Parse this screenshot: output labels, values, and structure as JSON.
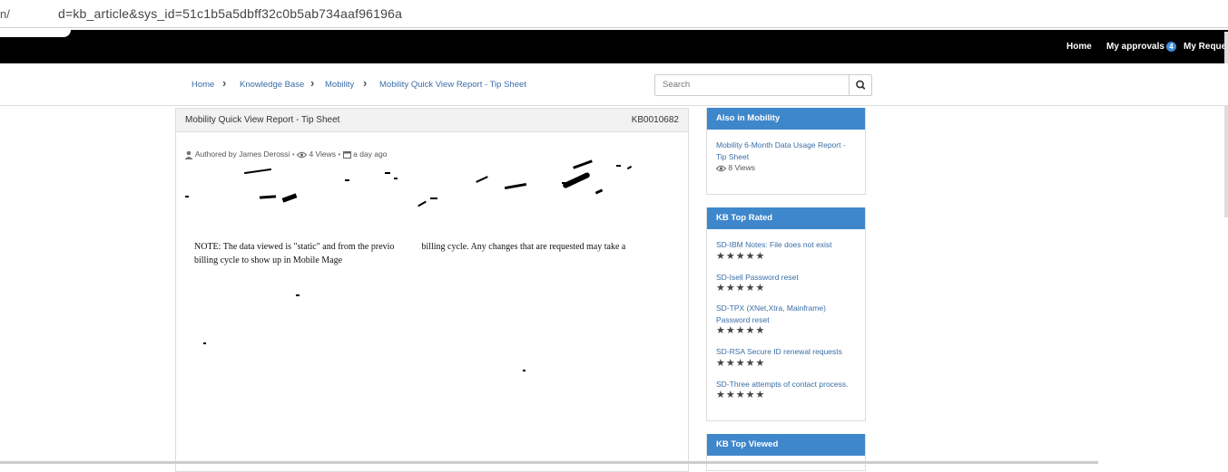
{
  "browser": {
    "url_prefix": "n/",
    "url": "d=kb_article&sys_id=51c1b5a5dbff32c0b5ab734aaf96196a"
  },
  "nav": {
    "home": "Home",
    "approvals": "My approvals",
    "approvals_count": "4",
    "requests": "My Requests"
  },
  "breadcrumb": {
    "items": [
      "Home",
      "Knowledge Base",
      "Mobility",
      "Mobility Quick View Report - Tip Sheet"
    ]
  },
  "search": {
    "placeholder": "Search"
  },
  "article": {
    "title": "Mobility Quick View Report - Tip Sheet",
    "number": "KB0010682",
    "author": "Authored by James Derossi",
    "views": "4 Views",
    "age": "a day ago",
    "note_line1": "NOTE: The data viewed is \"static\" and from the previo",
    "note_line1b": "billing cycle. Any changes that are requested may take a",
    "note_line2": "billing cycle to show up in Mobile M",
    "note_line2b": "age"
  },
  "sidebar": {
    "also_in": {
      "title": "Also in Mobility",
      "items": [
        {
          "label": "Mobility 6-Month Data Usage Report - Tip Sheet",
          "views": "8 Views"
        }
      ]
    },
    "top_rated": {
      "title": "KB Top Rated",
      "items": [
        {
          "label": "SD-IBM Notes: File does not exist",
          "stars": "★★★★★"
        },
        {
          "label": "SD-Isell Password reset",
          "stars": "★★★★★"
        },
        {
          "label": "SD-TPX (XNet,Xtra, Mainframe) Password reset",
          "stars": "★★★★★"
        },
        {
          "label": "SD-RSA Secure ID renewal requests",
          "stars": "★★★★★"
        },
        {
          "label": "SD-Three attempts of contact process.",
          "stars": "★★★★★"
        }
      ]
    },
    "top_viewed": {
      "title": "KB Top Viewed"
    }
  },
  "colors": {
    "nav_bg": "#000000",
    "card_header": "#3f87cb",
    "link": "#3a6fa7",
    "badge": "#3c8dde"
  },
  "icons": [
    "user-icon",
    "eye-icon",
    "calendar-icon",
    "search-icon",
    "chevron-right-icon"
  ]
}
